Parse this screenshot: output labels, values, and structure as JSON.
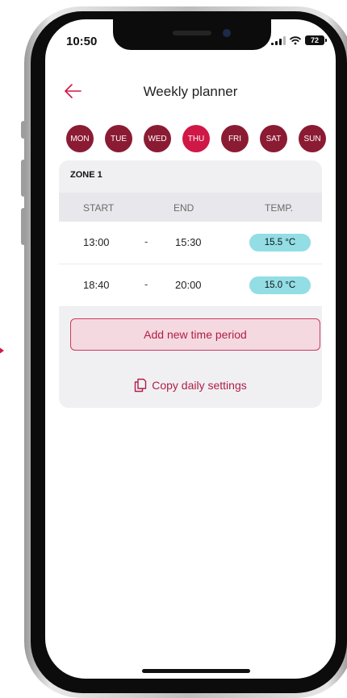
{
  "status_bar": {
    "time": "10:50",
    "battery_level": "72",
    "icons": [
      "signal-icon",
      "wifi-icon",
      "battery-icon"
    ]
  },
  "header": {
    "back_icon": "arrow-left-icon",
    "title": "Weekly planner"
  },
  "days": [
    {
      "label": "MON",
      "active": false
    },
    {
      "label": "TUE",
      "active": false
    },
    {
      "label": "WED",
      "active": false
    },
    {
      "label": "THU",
      "active": true
    },
    {
      "label": "FRI",
      "active": false
    },
    {
      "label": "SAT",
      "active": false
    },
    {
      "label": "SUN",
      "active": false
    }
  ],
  "zone": {
    "title": "ZONE 1",
    "columns": {
      "start": "START",
      "end": "END",
      "temp": "TEMP."
    },
    "separator": "-",
    "periods": [
      {
        "start": "13:00",
        "end": "15:30",
        "temp": "15.5 °C"
      },
      {
        "start": "18:40",
        "end": "20:00",
        "temp": "15.0 °C"
      }
    ],
    "add_button": "Add new time period",
    "copy_link": "Copy daily settings",
    "copy_icon": "copy-icon"
  },
  "colors": {
    "accent": "#d01846",
    "day_inactive": "#8b1b33",
    "temp_pill": "#93dde5",
    "card_bg": "#f0f0f3",
    "add_button_bg": "#f5d9e0"
  }
}
